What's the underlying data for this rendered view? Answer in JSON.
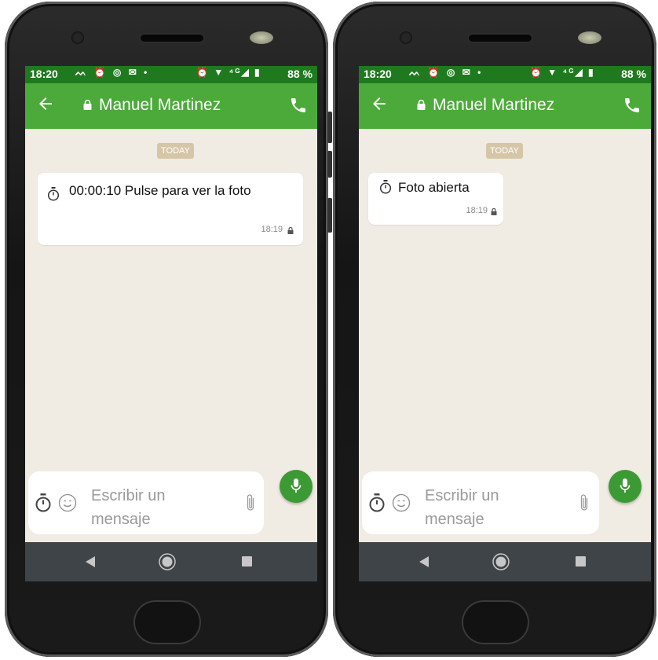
{
  "phones": [
    {
      "status_bar": {
        "time": "18:20",
        "icons_left": "ᨓ ⏰ ◎ ✉ •",
        "icons_right": "⏰ ▼ ⁴ᴳ◢ ▮",
        "battery": "88 %"
      },
      "header": {
        "contact_name": "Manuel Martinez"
      },
      "date_badge": "TODAY",
      "message": {
        "text": "00:00:10 Pulse para ver la foto",
        "time": "18:19"
      },
      "composer": {
        "placeholder": "Escribir un mensaje"
      }
    },
    {
      "status_bar": {
        "time": "18:20",
        "icons_left": "ᨓ ⏰ ◎ ✉ •",
        "icons_right": "⏰ ▼ ⁴ᴳ◢ ▮",
        "battery": "88 %"
      },
      "header": {
        "contact_name": "Manuel Martinez"
      },
      "date_badge": "TODAY",
      "message": {
        "text": "Foto abierta",
        "time": "18:19"
      },
      "composer": {
        "placeholder": "Escribir un mensaje"
      }
    }
  ],
  "colors": {
    "app_bar": "#4caa3a",
    "status_bar": "#1f7a1f",
    "chat_bg": "#f0ebe3",
    "mic_button": "#3c9a35",
    "nav_bar": "#3f4448"
  },
  "icons": [
    "back-arrow-icon",
    "lock-icon",
    "call-icon",
    "timer-icon",
    "emoji-icon",
    "attach-icon",
    "mic-icon",
    "nav-back-icon",
    "nav-home-icon",
    "nav-recent-icon"
  ]
}
